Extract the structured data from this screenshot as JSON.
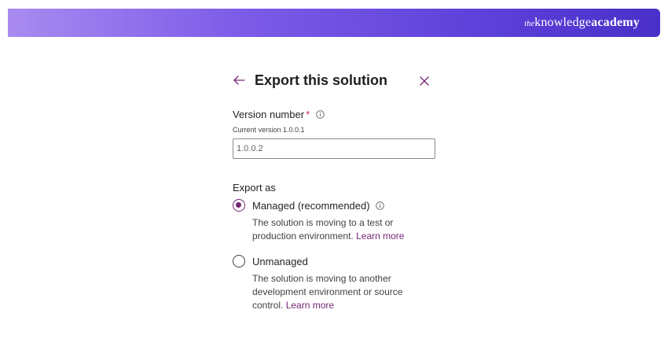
{
  "banner": {
    "brand_prefix": "the",
    "brand_light": "knowledge",
    "brand_bold": "academy"
  },
  "dialog": {
    "title": "Export this solution",
    "version": {
      "label": "Version number",
      "required_mark": "*",
      "current_text": "Current version 1.0.0.1",
      "value": "1.0.0.2"
    },
    "export_as": {
      "label": "Export as",
      "options": [
        {
          "label": "Managed (recommended)",
          "description": "The solution is moving to a test or production environment.",
          "link": "Learn more",
          "selected": true
        },
        {
          "label": "Unmanaged",
          "description": "The solution is moving to another development environment or source control.",
          "link": "Learn more",
          "selected": false
        }
      ]
    }
  },
  "colors": {
    "accent": "#742774",
    "required": "#c4314b",
    "banner_start": "#a98bf0",
    "banner_end": "#4a2fc9"
  }
}
